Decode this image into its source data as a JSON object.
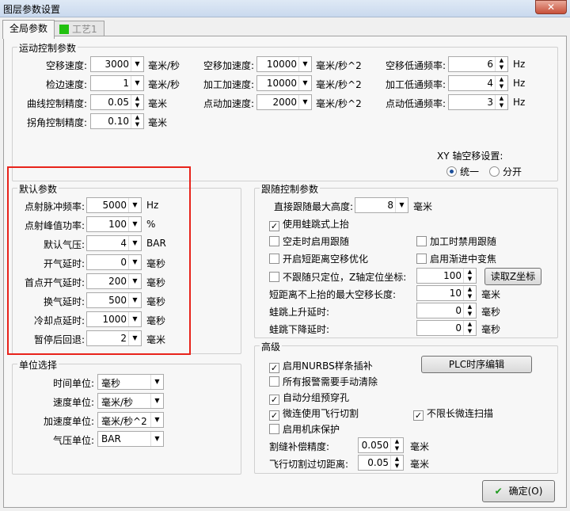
{
  "window": {
    "title": "图层参数设置",
    "close": "✕"
  },
  "tabs": [
    {
      "label": "全局参数"
    },
    {
      "label": "工艺1"
    }
  ],
  "motion": {
    "title": "运动控制参数",
    "col1": [
      {
        "label": "空移速度:",
        "value": "3000",
        "unit": "毫米/秒"
      },
      {
        "label": "检边速度:",
        "value": "1",
        "unit": "毫米/秒"
      },
      {
        "label": "曲线控制精度:",
        "value": "0.05",
        "unit": "毫米"
      },
      {
        "label": "拐角控制精度:",
        "value": "0.10",
        "unit": "毫米"
      }
    ],
    "col2": [
      {
        "label": "空移加速度:",
        "value": "10000",
        "unit": "毫米/秒^2"
      },
      {
        "label": "加工加速度:",
        "value": "10000",
        "unit": "毫米/秒^2"
      },
      {
        "label": "点动加速度:",
        "value": "2000",
        "unit": "毫米/秒^2"
      }
    ],
    "col3": [
      {
        "label": "空移低通频率:",
        "value": "6",
        "unit": "Hz"
      },
      {
        "label": "加工低通频率:",
        "value": "4",
        "unit": "Hz"
      },
      {
        "label": "点动低通频率:",
        "value": "3",
        "unit": "Hz"
      }
    ],
    "xy_label": "XY 轴空移设置:",
    "xy_options": [
      "统一",
      "分开"
    ]
  },
  "defaults": {
    "title": "默认参数",
    "rows": [
      {
        "label": "点射脉冲频率:",
        "value": "5000",
        "unit": "Hz"
      },
      {
        "label": "点射峰值功率:",
        "value": "100",
        "unit": "%"
      },
      {
        "label": "默认气压:",
        "value": "4",
        "unit": "BAR"
      },
      {
        "label": "开气延时:",
        "value": "0",
        "unit": "毫秒"
      },
      {
        "label": "首点开气延时:",
        "value": "200",
        "unit": "毫秒"
      },
      {
        "label": "换气延时:",
        "value": "500",
        "unit": "毫秒"
      },
      {
        "label": "冷却点延时:",
        "value": "1000",
        "unit": "毫秒"
      },
      {
        "label": "暂停后回退:",
        "value": "2",
        "unit": "毫米"
      }
    ]
  },
  "follow": {
    "title": "跟随控制参数",
    "max_height_label": "直接跟随最大高度:",
    "max_height_value": "8",
    "max_height_unit": "毫米",
    "use_jump": "使用蛙跳式上抬",
    "idle_follow": "空走时启用跟随",
    "disable_on_cut": "加工时禁用跟随",
    "short_opt": "开启短距离空移优化",
    "gradual_pierce": "启用渐进中变焦",
    "no_follow_z": "不跟随只定位，Z轴定位坐标:",
    "z_value": "100",
    "read_z": "读取Z坐标",
    "short_dist_label": "短距离不上抬的最大空移长度:",
    "short_dist_value": "10",
    "short_dist_unit": "毫米",
    "rise_label": "蛙跳上升延时:",
    "rise_value": "0",
    "rise_unit": "毫秒",
    "fall_label": "蛙跳下降延时:",
    "fall_value": "0",
    "fall_unit": "毫秒"
  },
  "units": {
    "title": "单位选择",
    "rows": [
      {
        "label": "时间单位:",
        "value": "毫秒"
      },
      {
        "label": "速度单位:",
        "value": "毫米/秒"
      },
      {
        "label": "加速度单位:",
        "value": "毫米/秒^2"
      },
      {
        "label": "气压单位:",
        "value": "BAR"
      }
    ]
  },
  "advanced": {
    "title": "高级",
    "nurbs": "启用NURBS样条插补",
    "manual_clear": "所有报警需要手动清除",
    "auto_pierce": "自动分组预穿孔",
    "micro_fly": "微连使用飞行切割",
    "unlimited_scan": "不限长微连扫描",
    "bed_protect": "启用机床保护",
    "plc_button": "PLC时序编辑",
    "kerf_label": "割缝补偿精度:",
    "kerf_value": "0.050",
    "kerf_unit": "毫米",
    "fly_label": "飞行切割过切距离:",
    "fly_value": "0.05",
    "fly_unit": "毫米"
  },
  "ok_button": "确定(O)"
}
